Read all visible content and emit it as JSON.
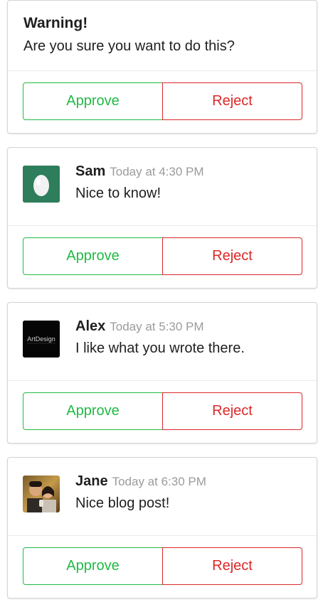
{
  "warning": {
    "title": "Warning!",
    "message": "Are you sure you want to do this?",
    "approve_label": "Approve",
    "reject_label": "Reject"
  },
  "comments": [
    {
      "author": "Sam",
      "date": "Today at 4:30 PM",
      "text": "Nice to know!",
      "avatar": "egg-avatar",
      "approve_label": "Approve",
      "reject_label": "Reject"
    },
    {
      "author": "Alex",
      "date": "Today at 5:30 PM",
      "text": "I like what you wrote there.",
      "avatar": "artdesign-logo",
      "approve_label": "Approve",
      "reject_label": "Reject"
    },
    {
      "author": "Jane",
      "date": "Today at 6:30 PM",
      "text": "Nice blog post!",
      "avatar": "photo-avatar",
      "approve_label": "Approve",
      "reject_label": "Reject"
    }
  ],
  "colors": {
    "approve": "#21ba45",
    "reject": "#db2828",
    "egg_bg": "#2e7d5b"
  }
}
